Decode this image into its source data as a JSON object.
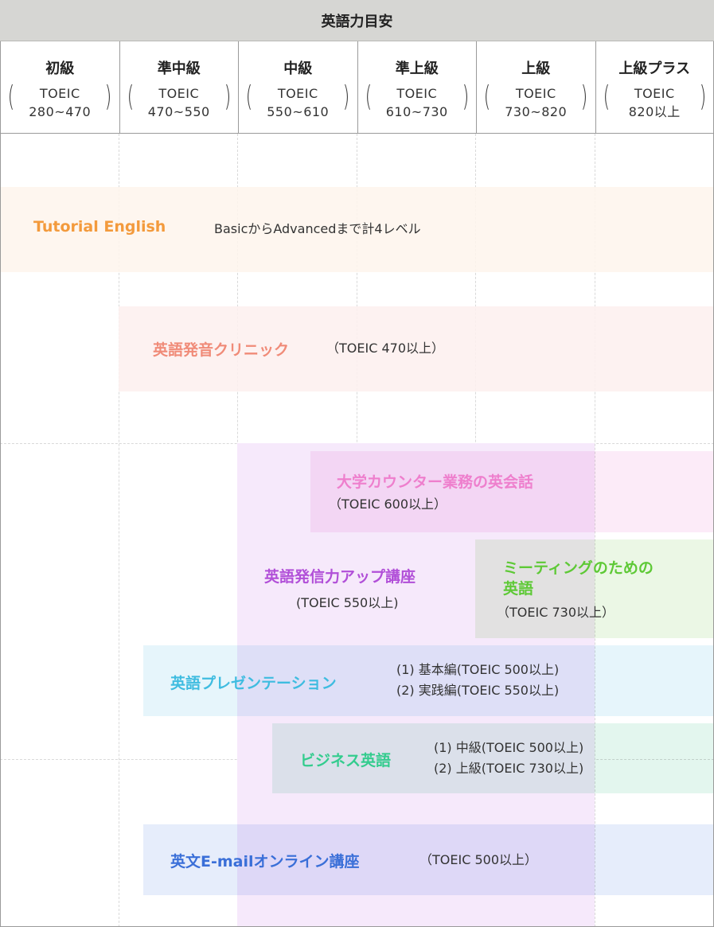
{
  "header": {
    "title": "英語力目安"
  },
  "levels": [
    {
      "name": "初級",
      "toeic_label": "TOEIC",
      "range": "280~470"
    },
    {
      "name": "準中級",
      "toeic_label": "TOEIC",
      "range": "470~550"
    },
    {
      "name": "中級",
      "toeic_label": "TOEIC",
      "range": "550~610"
    },
    {
      "name": "準上級",
      "toeic_label": "TOEIC",
      "range": "610~730"
    },
    {
      "name": "上級",
      "toeic_label": "TOEIC",
      "range": "730~820"
    },
    {
      "name": "上級プラス",
      "toeic_label": "TOEIC",
      "range": "820以上"
    }
  ],
  "courses": {
    "tutorial": {
      "title": "Tutorial English",
      "note": "BasicからAdvancedまで計4レベル",
      "color": "#f39a3c",
      "bg": "#fef5ec"
    },
    "pronunciation": {
      "title": "英語発音クリニック",
      "note": "（TOEIC 470以上）",
      "color": "#f08b78",
      "bg": "#fdf0ee"
    },
    "counter": {
      "title": "大学カウンター業務の英会話",
      "note": "（TOEIC 600以上）",
      "color": "#ee7fcd",
      "bg": "#fcebf8"
    },
    "output": {
      "title": "英語発信力アップ講座",
      "note": "(TOEIC 550以上)",
      "color": "#b14fd8",
      "bg": "#f6e9fb"
    },
    "meeting": {
      "title_line1": "ミーティングのための",
      "title_line2": "英語",
      "note": "（TOEIC 730以上）",
      "color": "#5ec936",
      "bg": "#ebf7e5"
    },
    "presentation": {
      "title": "英語プレゼンテーション",
      "note_line1": "(1) 基本編(TOEIC 500以上)",
      "note_line2": "(2) 実践編(TOEIC 550以上)",
      "color": "#3fbce0",
      "bg": "#e6f5fb"
    },
    "business": {
      "title": "ビジネス英語",
      "note_line1": "(1) 中級(TOEIC 500以上)",
      "note_line2": "(2) 上級(TOEIC 730以上)",
      "color": "#33cc8e",
      "bg": "#e3f6ee"
    },
    "email": {
      "title": "英文E-mailオンライン講座",
      "note": "（TOEIC 500以上）",
      "color": "#3a6fd8",
      "bg": "#e6edfb"
    }
  }
}
